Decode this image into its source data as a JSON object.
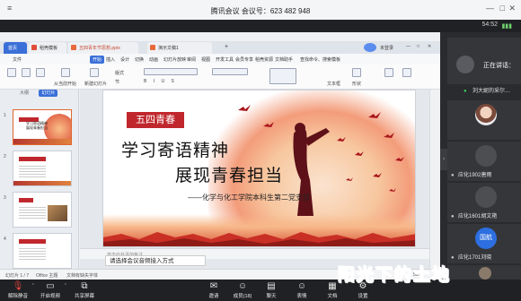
{
  "meeting": {
    "title": "腾讯会议 会议号：623 482 948",
    "time": "54:52"
  },
  "wps": {
    "tabs": [
      {
        "label": "首页"
      },
      {
        "label": "稻壳模板"
      },
      {
        "label": "五四青年节思想.pptx"
      },
      {
        "label": "演示文稿1"
      }
    ],
    "menu": [
      "文件",
      "开始",
      "插入",
      "设计",
      "切换",
      "动画",
      "幻灯片放映",
      "审阅",
      "视图",
      "开发工具",
      "会员专享",
      "稻壳资源",
      "文档助手"
    ],
    "search_label": "查找命令、搜索模板",
    "login_label": "未登录",
    "ribbon": {
      "from_current": "从当前开始",
      "new_slide": "新建幻灯片",
      "layout": "版式",
      "section": "节",
      "text_box": "文本框",
      "shape": "形状"
    },
    "thumb_tabs": [
      "大纲",
      "幻灯片"
    ],
    "thumbnails": [
      {
        "num": "1",
        "title": "学习寄语精神\n展现青春担当"
      },
      {
        "num": "2",
        "title": ""
      },
      {
        "num": "3",
        "title": ""
      },
      {
        "num": "4",
        "title": ""
      }
    ],
    "notes_placeholder": "单击此处添加备注",
    "status": {
      "slide_pos": "幻灯片 1 / 7",
      "theme": "Office 主题",
      "font_missing": "文档有缺失字体",
      "zoom": "59%"
    }
  },
  "slide": {
    "tag": "五四青春",
    "headline1": "学习寄语精神",
    "headline2": "展现青春担当",
    "subtitle": "——化学与化工学院本科生第二党支部"
  },
  "toast": "请选择会议音频接入方式",
  "panel": {
    "speaking_label": "正在讲话：",
    "participants": [
      {
        "name": "刘大妮的采尔…"
      },
      {
        "name": ""
      },
      {
        "name": "应化1902唐雨"
      },
      {
        "name": "应化1601胡文艳"
      },
      {
        "name": "应化1701刘晓"
      },
      {
        "name": ""
      }
    ],
    "avatar_text": "国航"
  },
  "toolbar": {
    "items": [
      {
        "label": "解除静音",
        "icon": "mic-off-icon"
      },
      {
        "label": "开启视频",
        "icon": "camera-off-icon"
      },
      {
        "label": "共享屏幕",
        "icon": "share-screen-icon"
      },
      {
        "label": "邀请",
        "icon": "invite-icon"
      },
      {
        "label": "成员(18)",
        "icon": "members-icon"
      },
      {
        "label": "聊天",
        "icon": "chat-icon"
      },
      {
        "label": "表情",
        "icon": "emoji-icon"
      },
      {
        "label": "文档",
        "icon": "document-icon"
      },
      {
        "label": "设置",
        "icon": "settings-icon"
      }
    ]
  },
  "watermark": "阳光下的土地"
}
